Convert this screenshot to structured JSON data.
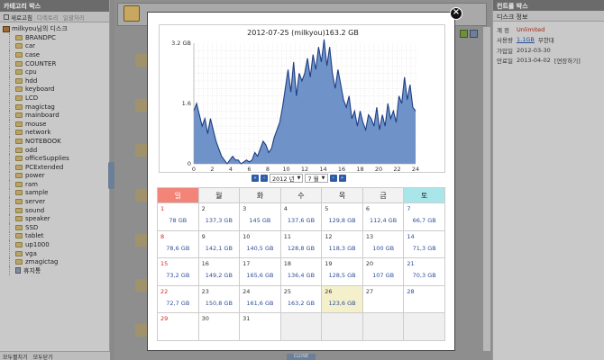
{
  "sidebar": {
    "title": "카테고리 박스",
    "tab_refresh": "새로고침",
    "tab_a": "디렉토리",
    "tab_b": "일괄처리",
    "root_label": "milkyou님의 디스크",
    "folders": [
      "BRANDPC",
      "car",
      "case",
      "COUNTER",
      "cpu",
      "hdd",
      "keyboard",
      "LCD",
      "magictag",
      "mainboard",
      "mouse",
      "network",
      "NOTEBOOK",
      "odd",
      "officeSupplies",
      "PCExtended",
      "power",
      "ram",
      "sample",
      "server",
      "sound",
      "speaker",
      "SSD",
      "tablet",
      "up1000",
      "vga",
      "zmagictag"
    ],
    "trash_label": "휴지통",
    "footer_expand": "모두펼치기",
    "footer_collapse": "모두닫기"
  },
  "center": {
    "bottom_tab": "CLOSE"
  },
  "right_panel": {
    "title": "컨트롤 박스",
    "subtitle": "디스크 정보",
    "rows": [
      {
        "key": "계 정",
        "value": "Unlimited",
        "style": "red"
      },
      {
        "key": "사용량",
        "value": "1.1GB",
        "extra": "무한대",
        "style": "blue"
      },
      {
        "key": "가입일",
        "value": "2012-03-30",
        "style": "plain"
      },
      {
        "key": "만료일",
        "value": "2013-04-02",
        "extra": "[연장하기]",
        "style": "plain"
      }
    ]
  },
  "modal": {
    "close_label": "×",
    "pager": {
      "year": "2012 년",
      "month": "7 월",
      "first": "«",
      "prev": "‹",
      "next": "›",
      "last": "»"
    },
    "weekdays": [
      "일",
      "월",
      "화",
      "수",
      "목",
      "금",
      "토"
    ],
    "calendar": [
      [
        {
          "d": "1",
          "v": "78 GB"
        },
        {
          "d": "2",
          "v": "137,3 GB"
        },
        {
          "d": "3",
          "v": "145 GB"
        },
        {
          "d": "4",
          "v": "137,6 GB"
        },
        {
          "d": "5",
          "v": "129,8 GB"
        },
        {
          "d": "6",
          "v": "112,4 GB"
        },
        {
          "d": "7",
          "v": "66,7 GB"
        }
      ],
      [
        {
          "d": "8",
          "v": "78,6 GB"
        },
        {
          "d": "9",
          "v": "142,1 GB"
        },
        {
          "d": "10",
          "v": "140,5 GB"
        },
        {
          "d": "11",
          "v": "128,8 GB"
        },
        {
          "d": "12",
          "v": "118,3 GB"
        },
        {
          "d": "13",
          "v": "100 GB"
        },
        {
          "d": "14",
          "v": "71,3 GB"
        }
      ],
      [
        {
          "d": "15",
          "v": "73,2 GB"
        },
        {
          "d": "16",
          "v": "149,2 GB"
        },
        {
          "d": "17",
          "v": "165,6 GB"
        },
        {
          "d": "18",
          "v": "136,4 GB"
        },
        {
          "d": "19",
          "v": "128,5 GB"
        },
        {
          "d": "20",
          "v": "107 GB"
        },
        {
          "d": "21",
          "v": "70,3 GB"
        }
      ],
      [
        {
          "d": "22",
          "v": "72,7 GB"
        },
        {
          "d": "23",
          "v": "150,8 GB"
        },
        {
          "d": "24",
          "v": "161,6 GB"
        },
        {
          "d": "25",
          "v": "163,2 GB"
        },
        {
          "d": "26",
          "v": "123,6 GB",
          "today": true
        },
        {
          "d": "27",
          "v": ""
        },
        {
          "d": "28",
          "v": ""
        }
      ],
      [
        {
          "d": "29",
          "v": ""
        },
        {
          "d": "30",
          "v": ""
        },
        {
          "d": "31",
          "v": ""
        },
        {
          "d": "",
          "v": "",
          "empty": true
        },
        {
          "d": "",
          "v": "",
          "empty": true
        },
        {
          "d": "",
          "v": "",
          "empty": true
        },
        {
          "d": "",
          "v": "",
          "empty": true
        }
      ]
    ]
  },
  "chart_data": {
    "type": "area",
    "title": "2012-07-25 (milkyou)163.2 GB",
    "xlabel": "",
    "ylabel": "",
    "xlim": [
      0,
      24
    ],
    "ylim": [
      0,
      3.2
    ],
    "xticks": [
      0,
      2,
      4,
      6,
      8,
      10,
      12,
      14,
      16,
      18,
      20,
      22,
      24
    ],
    "yticks": [
      {
        "v": 3.2,
        "label": "3.2 GB"
      },
      {
        "v": 1.6,
        "label": "1.6"
      },
      {
        "v": 0,
        "label": "0"
      }
    ],
    "grid": true,
    "fill_color": "#6f93c9",
    "line_color": "#1e3f85",
    "x": [
      0,
      0.3,
      0.6,
      0.9,
      1.2,
      1.5,
      1.8,
      2.1,
      2.4,
      2.7,
      3.0,
      3.3,
      3.6,
      3.9,
      4.2,
      4.5,
      4.8,
      5.1,
      5.4,
      5.7,
      6.0,
      6.3,
      6.6,
      6.9,
      7.2,
      7.5,
      7.8,
      8.1,
      8.4,
      8.7,
      9.0,
      9.3,
      9.6,
      9.9,
      10.2,
      10.5,
      10.8,
      11.1,
      11.4,
      11.7,
      12.0,
      12.3,
      12.6,
      12.9,
      13.2,
      13.5,
      13.8,
      14.1,
      14.4,
      14.7,
      15.0,
      15.3,
      15.6,
      15.9,
      16.2,
      16.5,
      16.8,
      17.1,
      17.4,
      17.7,
      18.0,
      18.3,
      18.6,
      18.9,
      19.2,
      19.5,
      19.8,
      20.1,
      20.4,
      20.7,
      21.0,
      21.3,
      21.6,
      21.9,
      22.2,
      22.5,
      22.8,
      23.1,
      23.4,
      23.7,
      24.0
    ],
    "values": [
      1.4,
      1.6,
      1.3,
      1.0,
      1.2,
      0.8,
      1.2,
      0.9,
      0.6,
      0.4,
      0.2,
      0.1,
      0.0,
      0.1,
      0.2,
      0.1,
      0.1,
      0.0,
      0.05,
      0.1,
      0.05,
      0.1,
      0.3,
      0.2,
      0.4,
      0.6,
      0.5,
      0.3,
      0.4,
      0.7,
      0.9,
      1.1,
      1.5,
      2.0,
      2.5,
      1.9,
      2.7,
      1.8,
      2.4,
      2.2,
      2.4,
      2.8,
      2.3,
      2.9,
      2.5,
      3.1,
      2.7,
      3.3,
      2.6,
      3.1,
      2.4,
      2.0,
      2.5,
      2.1,
      1.7,
      1.5,
      1.8,
      1.2,
      1.4,
      1.0,
      1.4,
      1.1,
      0.9,
      1.3,
      1.2,
      1.0,
      1.5,
      0.9,
      1.3,
      1.0,
      1.6,
      1.2,
      1.4,
      1.1,
      1.8,
      1.6,
      2.3,
      1.7,
      2.1,
      1.5,
      1.4
    ]
  }
}
